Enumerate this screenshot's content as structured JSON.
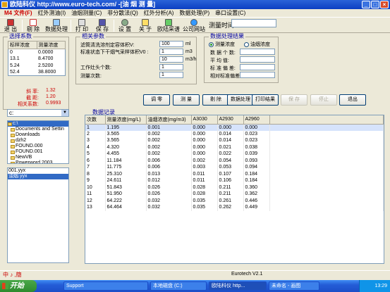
{
  "window": {
    "title": "欧陆科仪  http://www.euro-tech.com/ -[油 烟 测 量]"
  },
  "menu": [
    "M4 文件(F)",
    "红外测油(I)",
    "油烟测量(C)",
    "非分散法(Q)",
    "红外分析(A)",
    "数据处理(P)",
    "串口设置(C)"
  ],
  "toolbar": {
    "exit": "退 出",
    "remove": "剔 除",
    "process": "数据处理",
    "print": "打 印",
    "save": "保 存",
    "settings": "设 置",
    "about": "关 于",
    "spectrum": "欧陆采谱",
    "website": "公司网站",
    "meas_time_label": "测量时间:",
    "meas_time_value": ""
  },
  "coef": {
    "title": "选择系数",
    "headers": [
      "标样浓度",
      "测量浓度"
    ],
    "rows": [
      [
        "0",
        "0.0000"
      ],
      [
        "13.1",
        "8.4700"
      ],
      [
        "5.24",
        "2.5200"
      ],
      [
        "52.4",
        "38.8000"
      ]
    ]
  },
  "stats": {
    "slope_label": "斜    率:",
    "slope": "1.32",
    "intercept_label": "截    距:",
    "intercept": "1.20",
    "corr_label": "相关系数:",
    "corr": "0.9993"
  },
  "drive": {
    "value": "c:"
  },
  "tree": [
    {
      "label": "c:\\",
      "open": true
    },
    {
      "label": "Documents and Settin",
      "open": false
    },
    {
      "label": "Downloads",
      "open": false
    },
    {
      "label": "dzh2",
      "open": false
    },
    {
      "label": "FOUND.000",
      "open": false
    },
    {
      "label": "FOUND.001",
      "open": false
    },
    {
      "label": "NewVB",
      "open": false
    },
    {
      "label": "Powerword 2003",
      "open": false
    }
  ],
  "files": [
    {
      "label": "001.yyx",
      "selected": false
    },
    {
      "label": "油烟.yyx",
      "selected": true
    }
  ],
  "params": {
    "title": "相关参数",
    "vol_label": "滤筒清洗溶剂定容体积V:",
    "vol_value": "100",
    "vol_unit": "ml",
    "sample_label": "标准状态下干烟气采样体积V0 :",
    "sample_value": "1",
    "sample_unit": "m3",
    "flow_value": "10",
    "flow_unit": "m3/h",
    "heads_label": "工作灶头个数:",
    "heads_value": "1",
    "count_label": "测量次数:",
    "count_value": "1"
  },
  "results": {
    "title": "数据处理结果",
    "radio_measured": "测量浓度",
    "radio_smoke": "油烟浓度",
    "count_label": "数 据 个 数:",
    "mean_label": "平   均   值:",
    "std_label": "标 准 偏 差:",
    "rsd_label": "相对标准偏差:"
  },
  "buttons": {
    "zero": "调 零",
    "measure": "测 量",
    "remove": "剔 除",
    "process": "数据处理",
    "print": "打印结果",
    "save": "保 存",
    "stop": "停止",
    "exit": "退出"
  },
  "records": {
    "title": "数据记录",
    "headers": [
      "次数",
      "测量浓度(mg/L)",
      "油烟浓度(mg/m3)",
      "A3030",
      "A2930",
      "A2960"
    ],
    "rows": [
      [
        "1",
        "1.195",
        "0.001",
        "0.000",
        "0.000",
        "0.000"
      ],
      [
        "2",
        "3.565",
        "0.002",
        "0.000",
        "0.014",
        "0.023"
      ],
      [
        "3",
        "3.565",
        "0.002",
        "0.000",
        "0.014",
        "0.023"
      ],
      [
        "4",
        "4.320",
        "0.002",
        "0.000",
        "0.021",
        "0.038"
      ],
      [
        "5",
        "4.455",
        "0.002",
        "0.000",
        "0.022",
        "0.039"
      ],
      [
        "6",
        "11.184",
        "0.006",
        "0.002",
        "0.054",
        "0.093"
      ],
      [
        "7",
        "11.775",
        "0.006",
        "0.003",
        "0.053",
        "0.094"
      ],
      [
        "8",
        "25.310",
        "0.013",
        "0.011",
        "0.107",
        "0.184"
      ],
      [
        "9",
        "24.611",
        "0.012",
        "0.011",
        "0.106",
        "0.184"
      ],
      [
        "10",
        "51.843",
        "0.026",
        "0.028",
        "0.211",
        "0.360"
      ],
      [
        "11",
        "51.950",
        "0.026",
        "0.028",
        "0.211",
        "0.362"
      ],
      [
        "12",
        "64.222",
        "0.032",
        "0.035",
        "0.261",
        "0.446"
      ],
      [
        "13",
        "64.464",
        "0.032",
        "0.035",
        "0.262",
        "0.449"
      ]
    ]
  },
  "status": {
    "version": "Eurotech    V2.1",
    "ime": "中 ♪ ,簡"
  },
  "taskbar": {
    "start": "开始",
    "tasks": [
      "Support",
      "本地磁盘 (C:)",
      "欧陆科仪 http...",
      "未命名 - 画图"
    ],
    "clock": "13:29"
  },
  "colors": {
    "title_bar": "#0b3fc2",
    "stat_red": "#cc0000",
    "group_title": "#0000a0",
    "selection": "#316ac5"
  }
}
